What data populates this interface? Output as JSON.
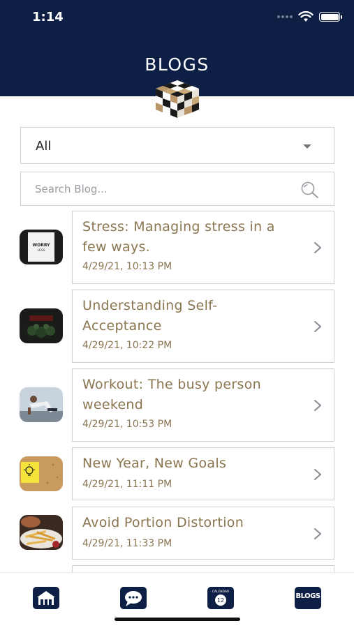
{
  "status_bar": {
    "time": "1:14"
  },
  "header": {
    "title": "BLOGS"
  },
  "filter": {
    "selected": "All"
  },
  "search": {
    "placeholder": "Search Blog..."
  },
  "blogs": [
    {
      "title_line1": "Stress: Managing stress in a",
      "title_line2": "few ways.",
      "date": "4/29/21, 10:13 PM",
      "thumb_text_1": "WORRY",
      "thumb_text_2": "LESS"
    },
    {
      "title_line1": "Understanding Self-",
      "title_line2": "Acceptance",
      "date": "4/29/21, 10:22 PM"
    },
    {
      "title_line1": "Workout: The busy person",
      "title_line2": "weekend",
      "date": "4/29/21, 10:53 PM"
    },
    {
      "title_line1": "New Year, New Goals",
      "title_line2": "",
      "date": "4/29/21, 11:11 PM"
    },
    {
      "title_line1": "Avoid Portion Distortion",
      "title_line2": "",
      "date": "4/29/21, 11:33 PM"
    }
  ],
  "tabbar": {
    "calendar_label": "CALENDAR",
    "calendar_day": "12",
    "blogs_label": "BLOGS"
  },
  "colors": {
    "header_bg": "#0d1f45",
    "accent_text": "#8a7550",
    "border": "#cfcfd4"
  }
}
